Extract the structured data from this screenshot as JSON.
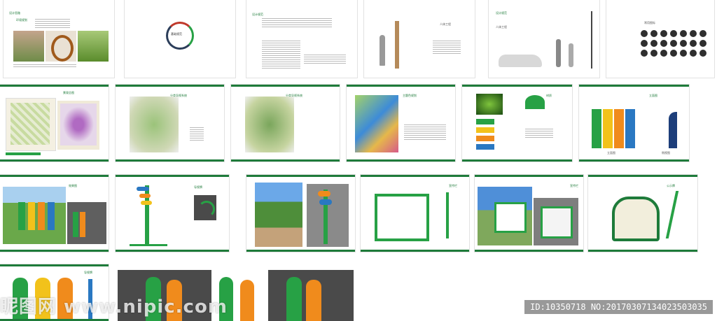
{
  "pages": {
    "p1_title": "设计思路",
    "p1_sub": "环境规划",
    "p2_title": "基础规范",
    "p3_title": "设计规范",
    "p4_label": "人体工程",
    "p5_title": "设计规范",
    "p5_label": "人体工程",
    "p6_title": "常用图标",
    "p7_title": "景观总图",
    "p8_title": "分类导视系统",
    "p9_title": "分类导视系统",
    "p10_title": "主题色规划",
    "p11_title": "材质",
    "p12_title": "立面图",
    "p13_title": "效果图",
    "p14_title": "导视牌",
    "p15_title": "宣传栏",
    "p16_title": "宣传栏",
    "p17_title": "公示牌",
    "p18_title": "导视牌",
    "p12_caption": "立面图",
    "p12_caption2": "侧视图"
  },
  "watermark": {
    "left": "昵图网 www.nipic.com",
    "right": "ID:10350718 NO:20170307134023503035"
  },
  "colors": {
    "accent": "#1e7b3a",
    "green": "#27a145",
    "orange": "#f08b1c",
    "yellow": "#f2c21b",
    "blue": "#2a78c2"
  }
}
